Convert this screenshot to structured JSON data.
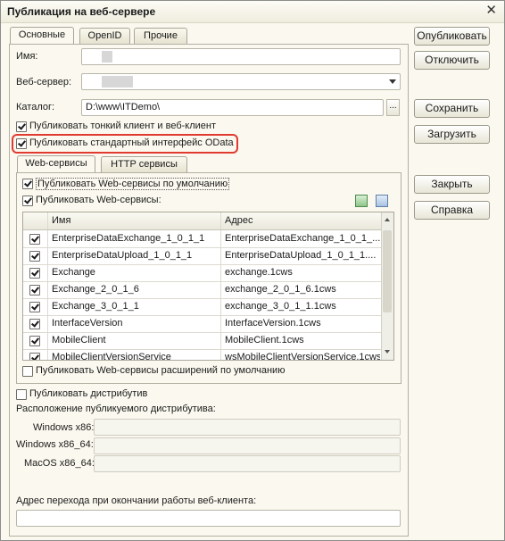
{
  "window": {
    "title": "Публикация на веб-сервере",
    "close": "✕"
  },
  "tabs": [
    "Основные",
    "OpenID",
    "Прочие"
  ],
  "fields": {
    "name_label": "Имя:",
    "server_label": "Веб-сервер:",
    "catalog_label": "Каталог:",
    "catalog_value": "D:\\www\\ITDemo\\",
    "browse": "..."
  },
  "checks": {
    "thin_client": "Публиковать тонкий клиент и веб-клиент",
    "odata": "Публиковать стандартный интерфейс OData"
  },
  "subtabs": [
    "Web-сервисы",
    "HTTP сервисы"
  ],
  "ws": {
    "default_label": "Публиковать Web-сервисы по умолчанию",
    "publish_label": "Публиковать Web-сервисы:",
    "extensions_label": "Публиковать Web-сервисы расширений по умолчанию",
    "columns": [
      "Имя",
      "Адрес"
    ],
    "rows": [
      {
        "name": "EnterpriseDataExchange_1_0_1_1",
        "address": "EnterpriseDataExchange_1_0_1_..."
      },
      {
        "name": "EnterpriseDataUpload_1_0_1_1",
        "address": "EnterpriseDataUpload_1_0_1_1...."
      },
      {
        "name": "Exchange",
        "address": "exchange.1cws"
      },
      {
        "name": "Exchange_2_0_1_6",
        "address": "exchange_2_0_1_6.1cws"
      },
      {
        "name": "Exchange_3_0_1_1",
        "address": "exchange_3_0_1_1.1cws"
      },
      {
        "name": "InterfaceVersion",
        "address": "InterfaceVersion.1cws"
      },
      {
        "name": "MobileClient",
        "address": "MobileClient.1cws"
      },
      {
        "name": "MobileClientVersionService",
        "address": "wsMobileClientVersionService.1cws"
      }
    ]
  },
  "distrib": {
    "publish_label": "Публиковать дистрибутив",
    "location_label": "Расположение публикуемого дистрибутива:",
    "win86": "Windows x86:",
    "win64": "Windows x86_64:",
    "mac": "MacOS x86_64:"
  },
  "redirect_label": "Адрес перехода при окончании работы веб-клиента:",
  "buttons": {
    "publish": "Опубликовать",
    "disable": "Отключить",
    "save": "Сохранить",
    "load": "Загрузить",
    "close": "Закрыть",
    "help": "Справка"
  },
  "accent": {
    "highlight": "#e03a31"
  }
}
